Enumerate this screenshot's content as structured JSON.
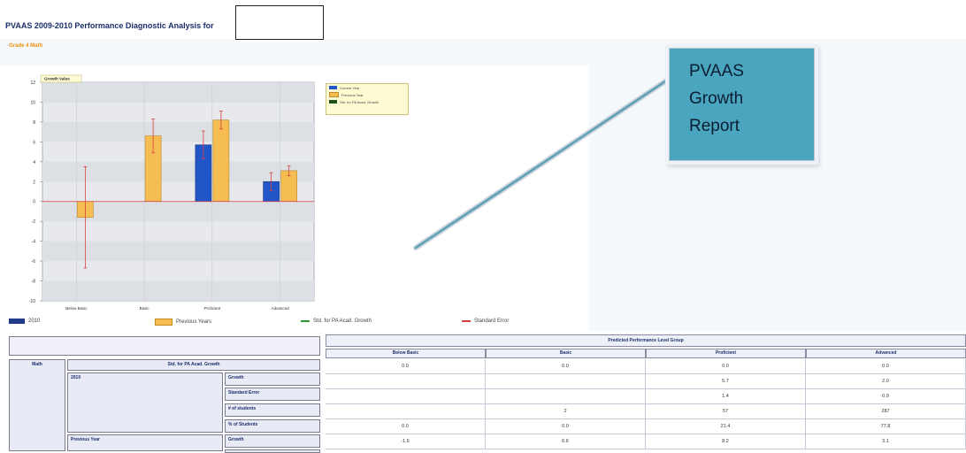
{
  "header": {
    "title": "PVAAS 2009-2010 Performance Diagnostic Analysis for",
    "subject_link": "Grade 4 Math"
  },
  "callout": {
    "lines": [
      "PVAAS",
      "Growth",
      "Report"
    ]
  },
  "chart_data": {
    "type": "bar",
    "title": "Growth Value",
    "categories": [
      "Below Basic",
      "Basic",
      "Proficient",
      "Advanced"
    ],
    "ylim": [
      -10,
      12
    ],
    "yticks": [
      -10,
      -8,
      -6,
      -4,
      -2,
      0,
      2,
      4,
      6,
      8,
      10,
      12
    ],
    "grid": true,
    "series": [
      {
        "name": "Current Year",
        "color": "#2255c8",
        "values": [
          null,
          null,
          5.7,
          2.0
        ],
        "errors": [
          null,
          null,
          1.4,
          0.9
        ]
      },
      {
        "name": "Previous Year",
        "color": "#f6bd52",
        "values": [
          -1.6,
          6.6,
          8.2,
          3.1
        ],
        "errors": [
          5.1,
          1.7,
          0.9,
          0.5
        ]
      }
    ],
    "reference_line": {
      "name": "Std. for PA Acad. Growth",
      "value": 0,
      "color": "#d94040"
    },
    "legend_inset": [
      "Current Year",
      "Previous Year",
      "Std. for PA Acad. Growth"
    ],
    "legend_bottom": [
      "2010",
      "Previous Years",
      "Std. for PA Acad. Growth",
      "Standard Error"
    ],
    "legend_colors": {
      "current": "#223a8a",
      "previous": "#f6bd52",
      "std": "#2f9a3a",
      "error": "#d94040"
    }
  },
  "table": {
    "group_header": "Predicted Performance Level Group",
    "subject": "Math",
    "std_header": "Std. for PA Acad. Growth",
    "columns": [
      "Below Basic",
      "Basic",
      "Proficient",
      "Advanced"
    ],
    "std_values": [
      "0.0",
      "0.0",
      "0.0",
      "0.0"
    ],
    "sections": [
      {
        "label": "2010",
        "rows": [
          {
            "label": "Growth",
            "values": [
              "",
              "",
              "5.7",
              "2.0"
            ]
          },
          {
            "label": "Standard Error",
            "values": [
              "",
              "",
              "1.4",
              "0.9"
            ]
          },
          {
            "label": "# of students",
            "values": [
              "",
              "2",
              "57",
              "287"
            ]
          },
          {
            "label": "% of Students",
            "values": [
              "0.0",
              "0.0",
              "21.4",
              "77.8"
            ]
          }
        ]
      },
      {
        "label": "Previous Year",
        "rows": [
          {
            "label": "Growth",
            "values": [
              "-1.6",
              "6.6",
              "8.2",
              "3.1"
            ]
          }
        ]
      }
    ]
  }
}
